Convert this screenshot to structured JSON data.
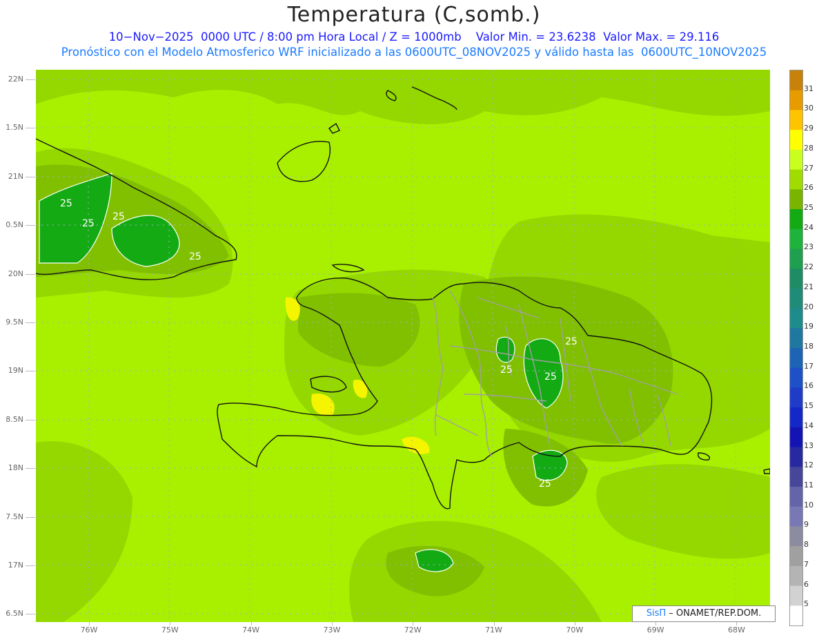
{
  "header": {
    "title": "Temperatura (C,somb.)",
    "line1": "10−Nov−2025  0000 UTC / 8:00 pm Hora Local / Z = 1000mb    Valor Min. = 23.6238  Valor Max. = 29.116",
    "line2": "Pronóstico con el Modelo Atmosferico WRF inicializado a las 0600UTC_08NOV2025 y válido hasta las  0600UTC_10NOV2025"
  },
  "axes": {
    "y_labels": [
      "22N",
      "1.5N",
      "21N",
      "0.5N",
      "20N",
      "9.5N",
      "19N",
      "8.5N",
      "18N",
      "7.5N",
      "17N",
      "6.5N"
    ],
    "x_labels": [
      "76W",
      "75W",
      "74W",
      "73W",
      "72W",
      "71W",
      "70W",
      "69W",
      "68W"
    ]
  },
  "contour_labels": [
    "25",
    "25",
    "25",
    "25",
    "25",
    "25",
    "25",
    "25"
  ],
  "colorbar": {
    "labels": [
      "31",
      "30",
      "29",
      "28",
      "27",
      "26",
      "25",
      "24",
      "23",
      "22",
      "21",
      "20",
      "19",
      "18",
      "17",
      "16",
      "15",
      "14",
      "13",
      "12",
      "11",
      "10",
      "9",
      "8",
      "7",
      "6",
      "5"
    ],
    "colors": [
      "#c8820a",
      "#e69b00",
      "#ffc400",
      "#ffff00",
      "#c8ff1e",
      "#a0dc00",
      "#78b400",
      "#14aa14",
      "#1eb43c",
      "#1ea050",
      "#1e8c64",
      "#1e8c78",
      "#1e8c8c",
      "#1e78a0",
      "#1e64b4",
      "#1e50c8",
      "#1e3cc8",
      "#1428c8",
      "#1414b4",
      "#2828a0",
      "#46469b",
      "#6464aa",
      "#7878b4",
      "#8c8ca0",
      "#a0a0a0",
      "#b4b4b4",
      "#d2d2d2",
      "#ffffff"
    ]
  },
  "credit": {
    "brand": "SisΠ",
    "text": "– ONAMET/REP.DOM."
  }
}
